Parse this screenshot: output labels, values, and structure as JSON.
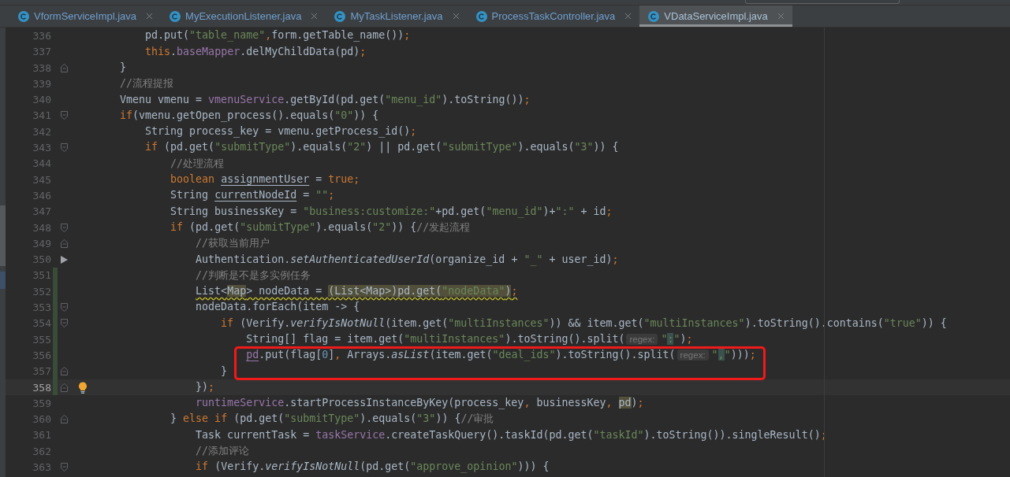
{
  "tabs": [
    {
      "label": "VformServiceImpl.java",
      "selected": false
    },
    {
      "label": "MyExecutionListener.java",
      "selected": false
    },
    {
      "label": "MyTaskListener.java",
      "selected": false
    },
    {
      "label": "ProcessTaskController.java",
      "selected": false
    },
    {
      "label": "VDataServiceImpl.java",
      "selected": true
    }
  ],
  "lines": [
    {
      "number": "336",
      "tokens": [
        {
          "kind": "plain",
          "text": "        pd.put("
        },
        {
          "kind": "string",
          "text": "\"table_name\""
        },
        {
          "kind": "punct",
          "text": ","
        },
        {
          "kind": "plain",
          "text": "form.getTable_name())"
        },
        {
          "kind": "punct",
          "text": ";"
        }
      ]
    },
    {
      "number": "337",
      "tokens": [
        {
          "kind": "keyword",
          "text": "        this"
        },
        {
          "kind": "plain",
          "text": "."
        },
        {
          "kind": "field",
          "text": "baseMapper"
        },
        {
          "kind": "plain",
          "text": ".delMyChildData(pd)"
        },
        {
          "kind": "punct",
          "text": ";"
        }
      ]
    },
    {
      "number": "338",
      "fold_end": true,
      "tokens": [
        {
          "kind": "plain",
          "text": "    }"
        }
      ]
    },
    {
      "number": "339",
      "tokens": [
        {
          "kind": "comment",
          "text": "    //流程提报"
        }
      ]
    },
    {
      "number": "340",
      "tokens": [
        {
          "kind": "plain",
          "text": "    Vmenu vmenu = "
        },
        {
          "kind": "field",
          "text": "vmenuService"
        },
        {
          "kind": "plain",
          "text": ".getById(pd.get("
        },
        {
          "kind": "string",
          "text": "\"menu_id\""
        },
        {
          "kind": "plain",
          "text": ").toString())"
        },
        {
          "kind": "punct",
          "text": ";"
        }
      ]
    },
    {
      "number": "341",
      "fold_start": true,
      "tokens": [
        {
          "kind": "keyword",
          "text": "    if"
        },
        {
          "kind": "plain",
          "text": "(vmenu.getOpen_process().equals("
        },
        {
          "kind": "string",
          "text": "\"0\""
        },
        {
          "kind": "plain",
          "text": ")) {"
        }
      ]
    },
    {
      "number": "342",
      "tokens": [
        {
          "kind": "plain",
          "text": "        String process_key = vmenu.getProcess_id()"
        },
        {
          "kind": "punct",
          "text": ";"
        }
      ]
    },
    {
      "number": "343",
      "fold_start": true,
      "tokens": [
        {
          "kind": "keyword",
          "text": "        if"
        },
        {
          "kind": "plain",
          "text": " (pd.get("
        },
        {
          "kind": "string",
          "text": "\"submitType\""
        },
        {
          "kind": "plain",
          "text": ").equals("
        },
        {
          "kind": "string",
          "text": "\"2\""
        },
        {
          "kind": "plain",
          "text": ") || pd.get("
        },
        {
          "kind": "string",
          "text": "\"submitType\""
        },
        {
          "kind": "plain",
          "text": ").equals("
        },
        {
          "kind": "string",
          "text": "\"3\""
        },
        {
          "kind": "plain",
          "text": ")) {"
        }
      ]
    },
    {
      "number": "344",
      "tokens": [
        {
          "kind": "comment",
          "text": "            //处理流程"
        }
      ]
    },
    {
      "number": "345",
      "tokens": [
        {
          "kind": "keyword",
          "text": "            boolean "
        },
        {
          "kind": "plain",
          "text": "assignmentUser",
          "underline": true
        },
        {
          "kind": "plain",
          "text": " = "
        },
        {
          "kind": "keyword",
          "text": "true"
        },
        {
          "kind": "punct",
          "text": ";"
        }
      ]
    },
    {
      "number": "346",
      "tokens": [
        {
          "kind": "plain",
          "text": "            String "
        },
        {
          "kind": "plain",
          "text": "currentNodeId",
          "underline": true
        },
        {
          "kind": "plain",
          "text": " = "
        },
        {
          "kind": "string",
          "text": "\"\""
        },
        {
          "kind": "punct",
          "text": ";"
        }
      ]
    },
    {
      "number": "347",
      "tokens": [
        {
          "kind": "plain",
          "text": "            String businessKey = "
        },
        {
          "kind": "string",
          "text": "\"business:customize:\""
        },
        {
          "kind": "plain",
          "text": "+pd.get("
        },
        {
          "kind": "string",
          "text": "\"menu_id\""
        },
        {
          "kind": "plain",
          "text": ")+"
        },
        {
          "kind": "string",
          "text": "\":\""
        },
        {
          "kind": "plain",
          "text": " + id"
        },
        {
          "kind": "punct",
          "text": ";"
        }
      ]
    },
    {
      "number": "348",
      "fold_start": true,
      "tokens": [
        {
          "kind": "keyword",
          "text": "            if"
        },
        {
          "kind": "plain",
          "text": " (pd.get("
        },
        {
          "kind": "string",
          "text": "\"submitType\""
        },
        {
          "kind": "plain",
          "text": ").equals("
        },
        {
          "kind": "string",
          "text": "\"2\""
        },
        {
          "kind": "plain",
          "text": ")) {"
        },
        {
          "kind": "comment",
          "text": "//发起流程"
        }
      ]
    },
    {
      "number": "349",
      "fold_end": true,
      "tokens": [
        {
          "kind": "comment",
          "text": "                //获取当前用户"
        }
      ]
    },
    {
      "number": "350",
      "arrow_mark": true,
      "tokens": [
        {
          "kind": "plain",
          "text": "                Authentication."
        },
        {
          "kind": "static",
          "text": "setAuthenticatedUserId"
        },
        {
          "kind": "plain",
          "text": "(organize_id + "
        },
        {
          "kind": "string",
          "text": "\"_\""
        },
        {
          "kind": "plain",
          "text": " + user_id)"
        },
        {
          "kind": "punct",
          "text": ";"
        }
      ]
    },
    {
      "number": "351",
      "changed": true,
      "tokens": [
        {
          "kind": "comment",
          "text": "                //判断是不是多实例任务"
        }
      ]
    },
    {
      "number": "352",
      "changed": true,
      "tokens": [
        {
          "kind": "plain",
          "text": "                List<",
          "wavy": true
        },
        {
          "kind": "plain",
          "text": "Map",
          "wavy": true,
          "marked": true
        },
        {
          "kind": "plain",
          "text": "> nodeData = ",
          "wavy": true
        },
        {
          "kind": "plain",
          "text": "(List<Map>)pd.get(",
          "wavy": true,
          "marked": true
        },
        {
          "kind": "string",
          "text": "\"nodeData\"",
          "wavy": true,
          "marked": true
        },
        {
          "kind": "plain",
          "text": ")",
          "wavy": true,
          "marked": true
        },
        {
          "kind": "punct",
          "text": ";",
          "wavy": true
        }
      ]
    },
    {
      "number": "353",
      "changed": true,
      "fold_start": true,
      "tokens": [
        {
          "kind": "plain",
          "text": "                nodeData.forEach(item -> {"
        }
      ]
    },
    {
      "number": "354",
      "changed": true,
      "fold_start": true,
      "tokens": [
        {
          "kind": "keyword",
          "text": "                    if"
        },
        {
          "kind": "plain",
          "text": " (Verify."
        },
        {
          "kind": "static",
          "text": "verifyIsNotNull"
        },
        {
          "kind": "plain",
          "text": "(item.get("
        },
        {
          "kind": "string",
          "text": "\"multiInstances\""
        },
        {
          "kind": "plain",
          "text": ")) && item.get("
        },
        {
          "kind": "string",
          "text": "\"multiInstances\""
        },
        {
          "kind": "plain",
          "text": ").toString().contains("
        },
        {
          "kind": "string",
          "text": "\"true\""
        },
        {
          "kind": "plain",
          "text": ")) {"
        }
      ]
    },
    {
      "number": "355",
      "changed": true,
      "tokens": [
        {
          "kind": "plain",
          "text": "                        String[] flag = item.get("
        },
        {
          "kind": "string",
          "text": "\"multiInstances\""
        },
        {
          "kind": "plain",
          "text": ").toString().split("
        },
        {
          "kind": "hint",
          "text": "regex:"
        },
        {
          "kind": "string",
          "text": "\""
        },
        {
          "kind": "string",
          "text": ":",
          "marked": true
        },
        {
          "kind": "string",
          "text": "\""
        },
        {
          "kind": "plain",
          "text": ")"
        },
        {
          "kind": "punct",
          "text": ";"
        }
      ]
    },
    {
      "number": "356",
      "changed": true,
      "boxed": true,
      "tokens": [
        {
          "kind": "field",
          "text": "                        pd",
          "underline": true
        },
        {
          "kind": "plain",
          "text": ".put(flag["
        },
        {
          "kind": "number",
          "text": "0"
        },
        {
          "kind": "plain",
          "text": "]"
        },
        {
          "kind": "punct",
          "text": ","
        },
        {
          "kind": "plain",
          "text": " Arrays."
        },
        {
          "kind": "static",
          "text": "asList"
        },
        {
          "kind": "plain",
          "text": "(item.get("
        },
        {
          "kind": "string",
          "text": "\"deal_ids\""
        },
        {
          "kind": "plain",
          "text": ").toString().split("
        },
        {
          "kind": "hint",
          "text": "regex:"
        },
        {
          "kind": "string",
          "text": "\""
        },
        {
          "kind": "string",
          "text": ",",
          "marked": true
        },
        {
          "kind": "string",
          "text": "\""
        },
        {
          "kind": "plain",
          "text": ")))"
        },
        {
          "kind": "punct",
          "text": ";"
        }
      ]
    },
    {
      "number": "357",
      "changed": true,
      "boxed": true,
      "fold_end": true,
      "tokens": [
        {
          "kind": "plain",
          "text": "                    }"
        }
      ]
    },
    {
      "number": "358",
      "changed": true,
      "current": true,
      "bulb": true,
      "fold_end": true,
      "tokens": [
        {
          "kind": "plain",
          "text": "                })"
        },
        {
          "kind": "punct",
          "text": ";"
        }
      ]
    },
    {
      "number": "359",
      "tokens": [
        {
          "kind": "field",
          "text": "                runtimeService"
        },
        {
          "kind": "plain",
          "text": ".startProcessInstanceByKey(process_key"
        },
        {
          "kind": "punct",
          "text": ","
        },
        {
          "kind": "plain",
          "text": " businessKey"
        },
        {
          "kind": "punct",
          "text": ", "
        },
        {
          "kind": "plain",
          "text": "pd",
          "marked": true
        },
        {
          "kind": "plain",
          "text": ")"
        },
        {
          "kind": "punct",
          "text": ";"
        }
      ]
    },
    {
      "number": "360",
      "fold_end": true,
      "tokens": [
        {
          "kind": "plain",
          "text": "            } "
        },
        {
          "kind": "keyword",
          "text": "else if"
        },
        {
          "kind": "plain",
          "text": " (pd.get("
        },
        {
          "kind": "string",
          "text": "\"submitType\""
        },
        {
          "kind": "plain",
          "text": ").equals("
        },
        {
          "kind": "string",
          "text": "\"3\""
        },
        {
          "kind": "plain",
          "text": ")) {"
        },
        {
          "kind": "comment",
          "text": "//审批"
        }
      ]
    },
    {
      "number": "361",
      "tokens": [
        {
          "kind": "plain",
          "text": "                Task currentTask = "
        },
        {
          "kind": "field",
          "text": "taskService"
        },
        {
          "kind": "plain",
          "text": ".createTaskQuery().taskId(pd.get("
        },
        {
          "kind": "string",
          "text": "\"taskId\""
        },
        {
          "kind": "plain",
          "text": ").toString()).singleResult()"
        },
        {
          "kind": "punct",
          "text": ";"
        }
      ]
    },
    {
      "number": "362",
      "tokens": [
        {
          "kind": "comment",
          "text": "                //添加评论"
        }
      ]
    },
    {
      "number": "363",
      "fold_start": true,
      "tokens": [
        {
          "kind": "keyword",
          "text": "                if"
        },
        {
          "kind": "plain",
          "text": " (Verify."
        },
        {
          "kind": "static",
          "text": "verifyIsNotNull"
        },
        {
          "kind": "plain",
          "text": "(pd.get("
        },
        {
          "kind": "string",
          "text": "\"approve_opinion\""
        },
        {
          "kind": "plain",
          "text": "))) {"
        }
      ]
    }
  ]
}
